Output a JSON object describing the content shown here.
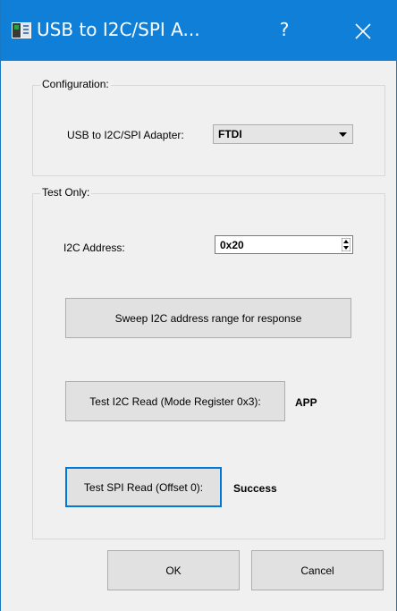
{
  "window": {
    "title": "USB to I2C/SPI A...",
    "help_label": "?",
    "titlebar_color": "#0f7fd7"
  },
  "configuration": {
    "legend": "Configuration:",
    "adapter_label": "USB to I2C/SPI Adapter:",
    "adapter_value": "FTDI"
  },
  "test_only": {
    "legend": "Test Only:",
    "i2c_address_label": "I2C Address:",
    "i2c_address_value": "0x20",
    "sweep_button": "Sweep I2C address range for response",
    "i2c_read_button": "Test I2C Read (Mode Register 0x3):",
    "i2c_read_result": "APP",
    "spi_read_button": "Test SPI Read (Offset 0):",
    "spi_read_result": "Success"
  },
  "footer": {
    "ok_label": "OK",
    "cancel_label": "Cancel"
  },
  "icons": [
    "app-icon",
    "help-icon",
    "close-icon",
    "dropdown-arrow-icon",
    "spin-arrows-icon"
  ]
}
